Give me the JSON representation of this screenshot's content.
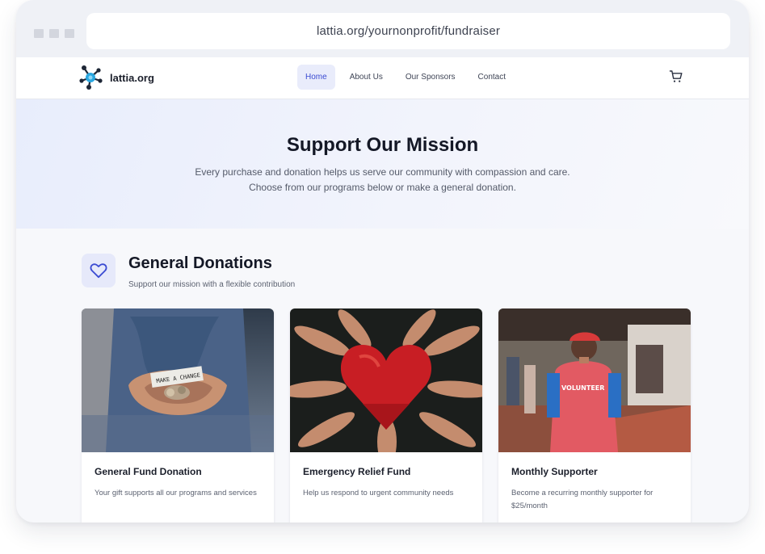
{
  "browser": {
    "url": "lattia.org/yournonprofit/fundraiser"
  },
  "nav": {
    "brand": "lattia.org",
    "items": [
      {
        "label": "Home",
        "active": true
      },
      {
        "label": "About Us",
        "active": false
      },
      {
        "label": "Our Sponsors",
        "active": false
      },
      {
        "label": "Contact",
        "active": false
      }
    ],
    "cart_icon": "shopping-cart-icon"
  },
  "hero": {
    "title": "Support Our Mission",
    "text": "Every purchase and donation helps us serve our community with compassion and care. Choose from our programs below or make a general donation."
  },
  "section": {
    "icon": "heart-icon",
    "title": "General Donations",
    "subtitle": "Support our mission with a flexible contribution"
  },
  "cards": [
    {
      "title": "General Fund Donation",
      "description": "Your gift supports all our programs and services",
      "image_text": "MAKE A CHANGE"
    },
    {
      "title": "Emergency Relief Fund",
      "description": "Help us respond to urgent community needs"
    },
    {
      "title": "Monthly Supporter",
      "description": "Become a recurring monthly supporter for $25/month",
      "image_text": "VOLUNTEER"
    }
  ],
  "colors": {
    "accent": "#3b4bd2",
    "accent_bg": "#e9ecfb",
    "heading": "#141826"
  }
}
